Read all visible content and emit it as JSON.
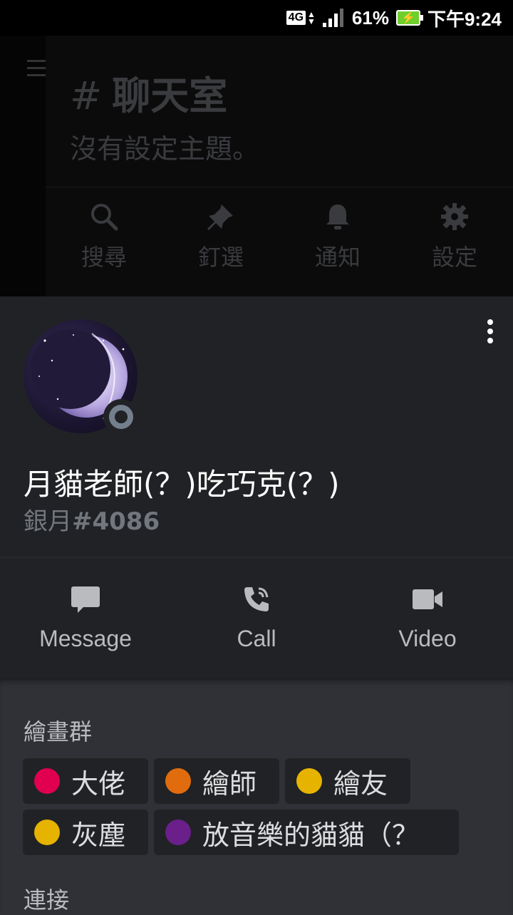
{
  "status_bar": {
    "network": "4G",
    "battery_percent": "61%",
    "time": "下午9:24"
  },
  "channel": {
    "hash": "#",
    "name": "聊天室",
    "topic": "沒有設定主題。",
    "actions": [
      {
        "icon": "search-icon",
        "label": "搜尋"
      },
      {
        "icon": "pin-icon",
        "label": "釘選"
      },
      {
        "icon": "bell-icon",
        "label": "通知"
      },
      {
        "icon": "gear-icon",
        "label": "設定"
      }
    ]
  },
  "profile": {
    "display_name": "月貓老師(？)吃巧克(？)",
    "username": "銀月",
    "discriminator": "#4086",
    "status": "offline",
    "actions": [
      {
        "icon": "message-icon",
        "label": "Message"
      },
      {
        "icon": "call-icon",
        "label": "Call"
      },
      {
        "icon": "video-icon",
        "label": "Video"
      }
    ]
  },
  "roles_section": {
    "title": "繪畫群",
    "roles": [
      {
        "name": "大佬",
        "color": "#e0004f"
      },
      {
        "name": "繪師",
        "color": "#e06c0e"
      },
      {
        "name": "繪友",
        "color": "#e6b400"
      },
      {
        "name": "灰塵",
        "color": "#e6b400"
      },
      {
        "name": "放音樂的貓貓（？",
        "color": "#6a1f8a"
      }
    ]
  },
  "connections_section": {
    "title": "連接"
  },
  "colors": {
    "sheet_bg": "#202225",
    "section_bg": "#2f3136",
    "muted_text": "#72767d"
  }
}
